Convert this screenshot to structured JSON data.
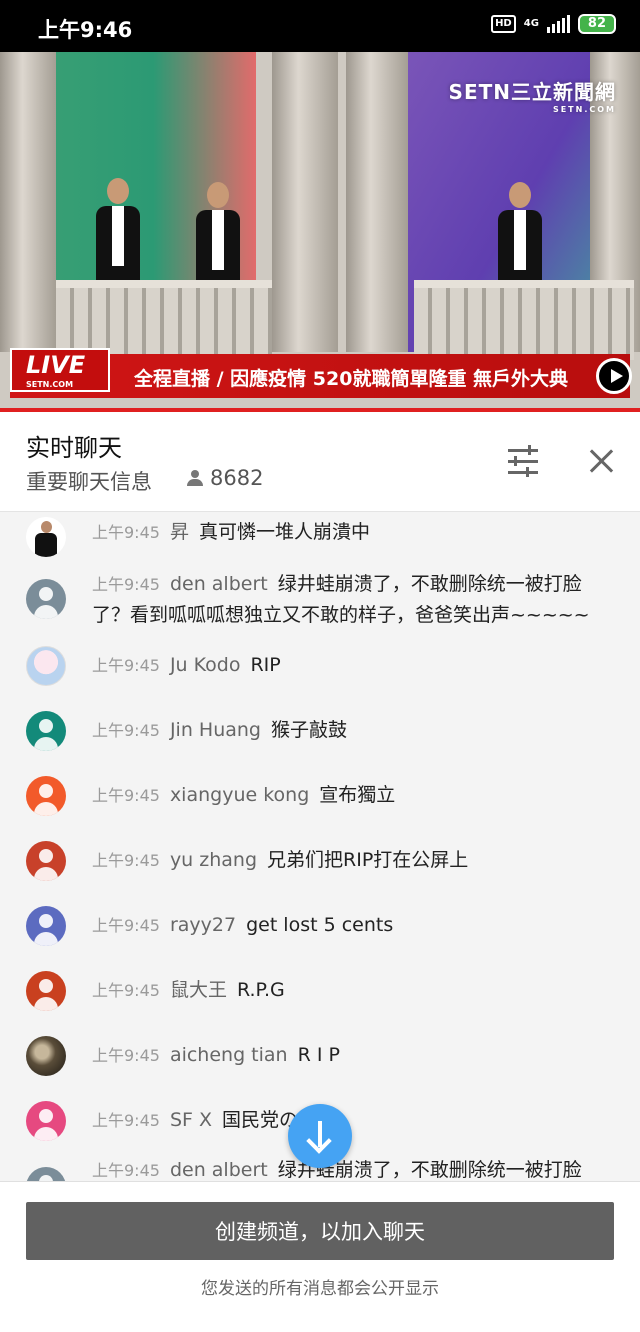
{
  "status_bar": {
    "time": "上午9:46",
    "hd": "HD",
    "network": "4G",
    "battery": "82"
  },
  "video": {
    "channel_logo": "SETN三立新聞網",
    "channel_url": "SETN.COM",
    "live_label": "LIVE",
    "live_sub": "SETN.COM",
    "ticker": "全程直播 / 因應疫情 520就職簡單隆重 無戶外大典"
  },
  "chat_header": {
    "title": "实时聊天",
    "subtitle": "重要聊天信息",
    "viewer_count": "8682"
  },
  "messages": [
    {
      "time": "上午9:45",
      "author": "昇",
      "text": "真可憐一堆人崩潰中",
      "avatar": "photo-man-suit"
    },
    {
      "time": "上午9:45",
      "author": "den albert",
      "text": "绿井蛙崩溃了，不敢删除统一被打脸了？看到呱呱呱想独立又不敢的样子，爸爸笑出声~~~~~",
      "avatar": "generic-user",
      "avatar_color": "#7b8d99"
    },
    {
      "time": "上午9:45",
      "author": "Ju Kodo",
      "text": "RIP",
      "avatar": "anime-avatar"
    },
    {
      "time": "上午9:45",
      "author": "Jin Huang",
      "text": "猴子敲鼓",
      "avatar": "generic-user",
      "avatar_color": "#138a7a"
    },
    {
      "time": "上午9:45",
      "author": "xiangyue kong",
      "text": "宣布獨立",
      "avatar": "generic-user",
      "avatar_color": "#f25a2a"
    },
    {
      "time": "上午9:45",
      "author": "yu zhang",
      "text": "兄弟们把RIP打在公屏上",
      "avatar": "generic-user",
      "avatar_color": "#c8412a"
    },
    {
      "time": "上午9:45",
      "author": "rayy27",
      "text": "get lost 5 cents",
      "avatar": "generic-user",
      "avatar_color": "#5c6bc0"
    },
    {
      "time": "上午9:45",
      "author": "鼠大王",
      "text": "R.P.G",
      "avatar": "generic-user",
      "avatar_color": "#c9401f"
    },
    {
      "time": "上午9:45",
      "author": "aicheng tian",
      "text": "R I P",
      "avatar": "game-avatar"
    },
    {
      "time": "上午9:45",
      "author": "SF X",
      "text": "国民党の…歌",
      "avatar": "generic-user",
      "avatar_color": "#e64980"
    },
    {
      "time": "上午9:45",
      "author": "den albert",
      "text": "绿井蛙崩溃了，不敢删除统一被打脸",
      "avatar": "generic-user",
      "avatar_color": "#7b8d99"
    }
  ],
  "bottom": {
    "create_channel": "创建频道，以加入聊天",
    "notice": "您发送的所有消息都会公开显示"
  },
  "colors": {
    "accent": "#45a3f3",
    "live_red": "#d01616",
    "button_gray": "#616161"
  }
}
